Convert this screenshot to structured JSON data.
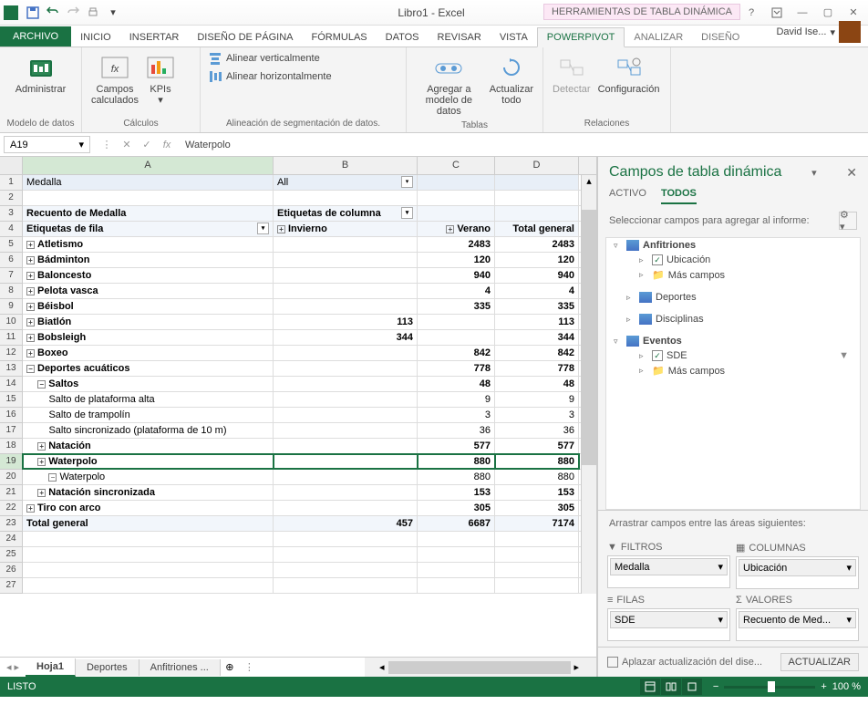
{
  "titlebar": {
    "title": "Libro1 - Excel",
    "context_tools": "HERRAMIENTAS DE TABLA DINÁMICA"
  },
  "tabs": {
    "file": "ARCHIVO",
    "home": "INICIO",
    "insert": "INSERTAR",
    "layout": "DISEÑO DE PÁGINA",
    "formulas": "FÓRMULAS",
    "data": "DATOS",
    "review": "REVISAR",
    "view": "VISTA",
    "powerpivot": "POWERPIVOT",
    "analyze": "ANALIZAR",
    "design": "DISEÑO"
  },
  "user": {
    "name": "David Ise..."
  },
  "ribbon": {
    "manage": "Administrar",
    "manage_grp": "Modelo de datos",
    "calc_fields": "Campos\ncalculados",
    "kpis": "KPIs",
    "calc_grp": "Cálculos",
    "align_v": "Alinear verticalmente",
    "align_h": "Alinear horizontalmente",
    "align_grp": "Alineación de segmentación de datos.",
    "add_model": "Agregar a\nmodelo de datos",
    "update_all": "Actualizar\ntodo",
    "tables_grp": "Tablas",
    "detect": "Detectar",
    "config": "Configuración",
    "rel_grp": "Relaciones"
  },
  "namebox": {
    "ref": "A19",
    "formula": "Waterpolo"
  },
  "cols": {
    "A": "A",
    "B": "B",
    "C": "C",
    "D": "D"
  },
  "sheet_tabs": {
    "hoja1": "Hoja1",
    "deportes": "Deportes",
    "anfitriones": "Anfitriones ..."
  },
  "rows": [
    {
      "n": 1,
      "a": "Medalla",
      "b": "All",
      "blue": true,
      "filterB": true
    },
    {
      "n": 2,
      "a": "",
      "b": "",
      "c": "",
      "d": ""
    },
    {
      "n": 3,
      "a": "Recuento de Medalla",
      "b": "Etiquetas de columna",
      "lblue": true,
      "bold": true,
      "filterB": true
    },
    {
      "n": 4,
      "a": "Etiquetas de fila",
      "b": "Invierno",
      "c": "Verano",
      "d": "Total general",
      "lblue": true,
      "bold": true,
      "filterA": true,
      "expB": true,
      "expC": true
    },
    {
      "n": 5,
      "a": "Atletismo",
      "c": "2483",
      "d": "2483",
      "bold": true,
      "exp": "+"
    },
    {
      "n": 6,
      "a": "Bádminton",
      "c": "120",
      "d": "120",
      "bold": true,
      "exp": "+"
    },
    {
      "n": 7,
      "a": "Baloncesto",
      "c": "940",
      "d": "940",
      "bold": true,
      "exp": "+"
    },
    {
      "n": 8,
      "a": "Pelota vasca",
      "c": "4",
      "d": "4",
      "bold": true,
      "exp": "+"
    },
    {
      "n": 9,
      "a": "Béisbol",
      "c": "335",
      "d": "335",
      "bold": true,
      "exp": "+"
    },
    {
      "n": 10,
      "a": "Biatlón",
      "b": "113",
      "d": "113",
      "bold": true,
      "exp": "+"
    },
    {
      "n": 11,
      "a": "Bobsleigh",
      "b": "344",
      "d": "344",
      "bold": true,
      "exp": "+"
    },
    {
      "n": 12,
      "a": "Boxeo",
      "c": "842",
      "d": "842",
      "bold": true,
      "exp": "+"
    },
    {
      "n": 13,
      "a": "Deportes acuáticos",
      "c": "778",
      "d": "778",
      "bold": true,
      "exp": "−"
    },
    {
      "n": 14,
      "a": "Saltos",
      "c": "48",
      "d": "48",
      "bold": true,
      "indent": 1,
      "exp": "−"
    },
    {
      "n": 15,
      "a": "Salto de plataforma alta",
      "c": "9",
      "d": "9",
      "indent": 2
    },
    {
      "n": 16,
      "a": "Salto de trampolín",
      "c": "3",
      "d": "3",
      "indent": 2
    },
    {
      "n": 17,
      "a": "Salto sincronizado (plataforma de 10 m)",
      "c": "36",
      "d": "36",
      "indent": 2
    },
    {
      "n": 18,
      "a": "Natación",
      "c": "577",
      "d": "577",
      "bold": true,
      "indent": 1,
      "exp": "+"
    },
    {
      "n": 19,
      "a": "Waterpolo",
      "c": "880",
      "d": "880",
      "bold": true,
      "indent": 1,
      "exp": "+",
      "sel": true
    },
    {
      "n": 20,
      "a": "Waterpolo",
      "c": "880",
      "d": "880",
      "indent": 2,
      "exp": "−"
    },
    {
      "n": 21,
      "a": "Natación sincronizada",
      "c": "153",
      "d": "153",
      "bold": true,
      "indent": 1,
      "exp": "+"
    },
    {
      "n": 22,
      "a": "Tiro con arco",
      "c": "305",
      "d": "305",
      "bold": true,
      "exp": "+"
    },
    {
      "n": 23,
      "a": "Total general",
      "b": "457",
      "c": "6687",
      "d": "7174",
      "lblue": true,
      "bold": true
    },
    {
      "n": 24
    },
    {
      "n": 25
    },
    {
      "n": 26
    },
    {
      "n": 27
    }
  ],
  "taskpane": {
    "title": "Campos de tabla dinámica",
    "tab_active": "ACTIVO",
    "tab_all": "TODOS",
    "hint": "Seleccionar campos para agregar al informe:",
    "fields": {
      "anfitriones": "Anfitriones",
      "ubicacion": "Ubicación",
      "mas": "Más campos",
      "deportes": "Deportes",
      "disciplinas": "Disciplinas",
      "eventos": "Eventos",
      "sde": "SDE"
    },
    "drag_hint": "Arrastrar campos entre las áreas siguientes:",
    "areas": {
      "filtros": "FILTROS",
      "columnas": "COLUMNAS",
      "filas": "FILAS",
      "valores": "VALORES"
    },
    "items": {
      "medalla": "Medalla",
      "ubicacion": "Ubicación",
      "sde": "SDE",
      "recuento": "Recuento de Med..."
    },
    "defer": "Aplazar actualización del dise...",
    "update": "ACTUALIZAR"
  },
  "statusbar": {
    "ready": "LISTO",
    "zoom": "100 %"
  }
}
